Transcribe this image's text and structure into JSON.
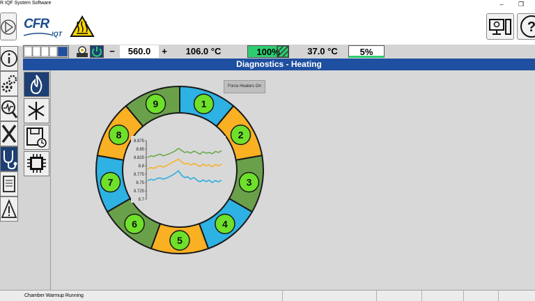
{
  "window": {
    "title": "R IQF System Software"
  },
  "app": {
    "logo_text": "CFR",
    "logo_sub": "IQT"
  },
  "status": {
    "setpoint": "560.0",
    "minus": "−",
    "plus": "+",
    "chamber_temp": "106.0 °C",
    "heater_power": "100%",
    "coolant_temp": "37.0 °C",
    "coolant_power": "5%"
  },
  "page": {
    "title": "Diagnostics - Heating"
  },
  "buttons": {
    "force_heaters": "Force Heaters On"
  },
  "heaters": {
    "zones": [
      "1",
      "2",
      "3",
      "4",
      "5",
      "6",
      "7",
      "8",
      "9"
    ],
    "colors": [
      "#2eb1e3",
      "#f9b023",
      "#6ba04b",
      "#2eb1e3",
      "#f9b023",
      "#6ba04b",
      "#2eb1e3",
      "#f9b023",
      "#6ba04b"
    ],
    "badge_color": "#6ee02a"
  },
  "chart_data": {
    "type": "line",
    "ylim": [
      8.7,
      8.875
    ],
    "yticks": [
      "8.875",
      "8.85",
      "8.825",
      "8.8",
      "8.775",
      "8.75",
      "8.725",
      "8.7"
    ],
    "series": [
      {
        "color": "#6aa84f",
        "values": [
          8.825,
          8.83,
          8.828,
          8.832,
          8.835,
          8.83,
          8.833,
          8.836,
          8.84,
          8.845,
          8.852,
          8.846,
          8.84,
          8.842,
          8.838,
          8.844,
          8.84,
          8.835,
          8.842,
          8.838,
          8.84,
          8.836,
          8.843,
          8.84,
          8.845
        ]
      },
      {
        "color": "#f6b12a",
        "values": [
          8.79,
          8.795,
          8.792,
          8.797,
          8.8,
          8.796,
          8.8,
          8.805,
          8.81,
          8.815,
          8.82,
          8.812,
          8.805,
          8.808,
          8.802,
          8.807,
          8.803,
          8.798,
          8.805,
          8.8,
          8.803,
          8.797,
          8.804,
          8.8,
          8.805
        ]
      },
      {
        "color": "#2aaee0",
        "values": [
          8.755,
          8.76,
          8.757,
          8.762,
          8.764,
          8.76,
          8.763,
          8.767,
          8.772,
          8.778,
          8.785,
          8.772,
          8.765,
          8.767,
          8.76,
          8.765,
          8.757,
          8.752,
          8.758,
          8.753,
          8.757,
          8.75,
          8.756,
          8.752,
          8.757
        ]
      }
    ]
  },
  "footer": {
    "status_text": "Chamber Warmup Running"
  },
  "accent": {
    "header_blue": "#1f4fa0",
    "active_nav": "#1d3f73",
    "ok_green": "#2ecc71"
  }
}
